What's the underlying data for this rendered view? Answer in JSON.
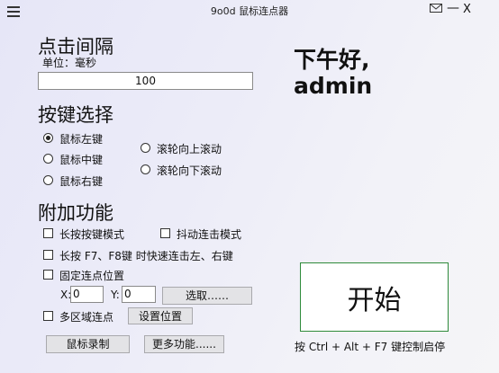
{
  "window": {
    "title": "9o0d 鼠标连点器"
  },
  "interval": {
    "heading": "点击间隔",
    "unit": "单位：毫秒",
    "value": "100"
  },
  "keys": {
    "heading": "按键选择",
    "options": [
      "鼠标左键",
      "鼠标中键",
      "鼠标右键",
      "滚轮向上滚动",
      "滚轮向下滚动"
    ],
    "selected": "鼠标左键"
  },
  "extras": {
    "heading": "附加功能",
    "long_press": "长按按键模式",
    "jitter": "抖动连击模式",
    "f7f8": "长按 F7、F8键 时快速连击左、右键",
    "fixed": "固定连点位置",
    "x_label": "X:",
    "x_value": "0",
    "y_label": "Y:",
    "y_value": "0",
    "pick_button": "选取……",
    "multi": "多区域连点",
    "set_pos_button": "设置位置"
  },
  "footer": {
    "record_button": "鼠标录制",
    "more_button": "更多功能......"
  },
  "greeting": {
    "line1": "下午好,",
    "line2": "admin"
  },
  "start": {
    "label": "开始",
    "hint": "按 Ctrl + Alt + F7 键控制启停"
  },
  "icons": [
    "menu-icon",
    "mail-icon",
    "minimize-icon",
    "close-icon"
  ],
  "colors": {
    "start_border": "#2e8a3a"
  }
}
